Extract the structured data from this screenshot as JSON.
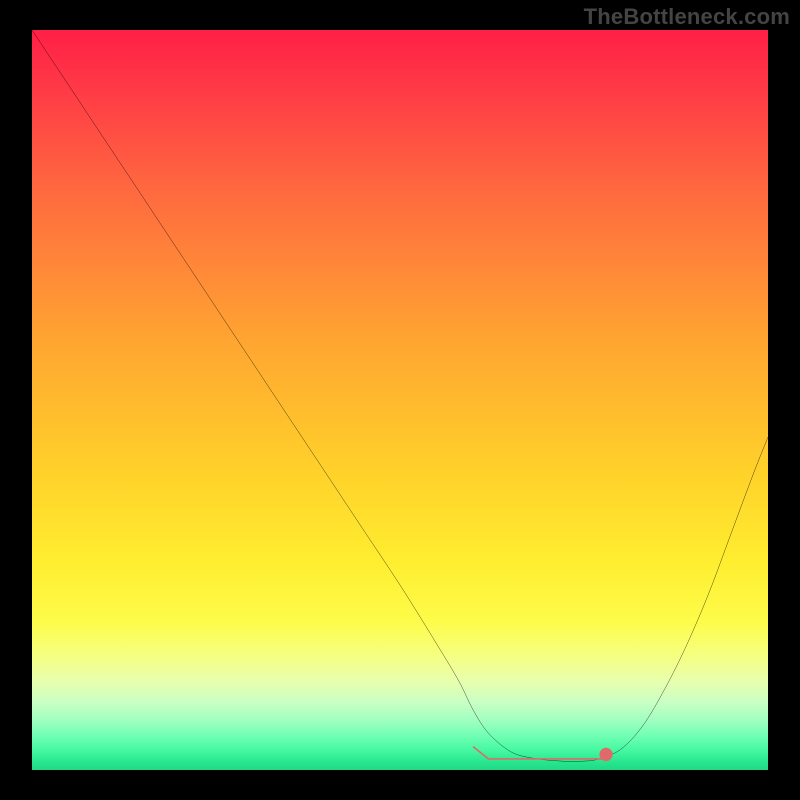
{
  "watermark": "TheBottleneck.com",
  "chart_data": {
    "type": "line",
    "title": "",
    "xlabel": "",
    "ylabel": "",
    "xlim": [
      0,
      100
    ],
    "ylim": [
      0,
      100
    ],
    "series": [
      {
        "name": "curve",
        "x": [
          0,
          5,
          10,
          15,
          20,
          25,
          30,
          35,
          40,
          45,
          50,
          55,
          58,
          60,
          62,
          65,
          68,
          72,
          75,
          77,
          80,
          83,
          86,
          89,
          92,
          95,
          98,
          100
        ],
        "values": [
          100,
          92.5,
          85,
          77.5,
          70,
          62.5,
          55,
          47.5,
          40,
          32.5,
          25,
          17,
          12,
          8,
          5,
          2.5,
          1.6,
          1.2,
          1.2,
          1.5,
          2.8,
          6,
          11,
          17,
          24,
          32,
          40,
          45
        ]
      }
    ],
    "markers": [
      {
        "name": "flat-segment",
        "x_start": 60,
        "x_end": 78,
        "y": 1.5,
        "color": "#e06a6a"
      },
      {
        "name": "end-dot",
        "x": 78,
        "y": 2.1,
        "color": "#e06a6a"
      }
    ],
    "background_gradient": {
      "stops": [
        {
          "pos": 0.0,
          "color": "#ff1f46"
        },
        {
          "pos": 0.5,
          "color": "#ffd22a"
        },
        {
          "pos": 0.8,
          "color": "#fdfc4a"
        },
        {
          "pos": 1.0,
          "color": "#22d885"
        }
      ]
    }
  }
}
